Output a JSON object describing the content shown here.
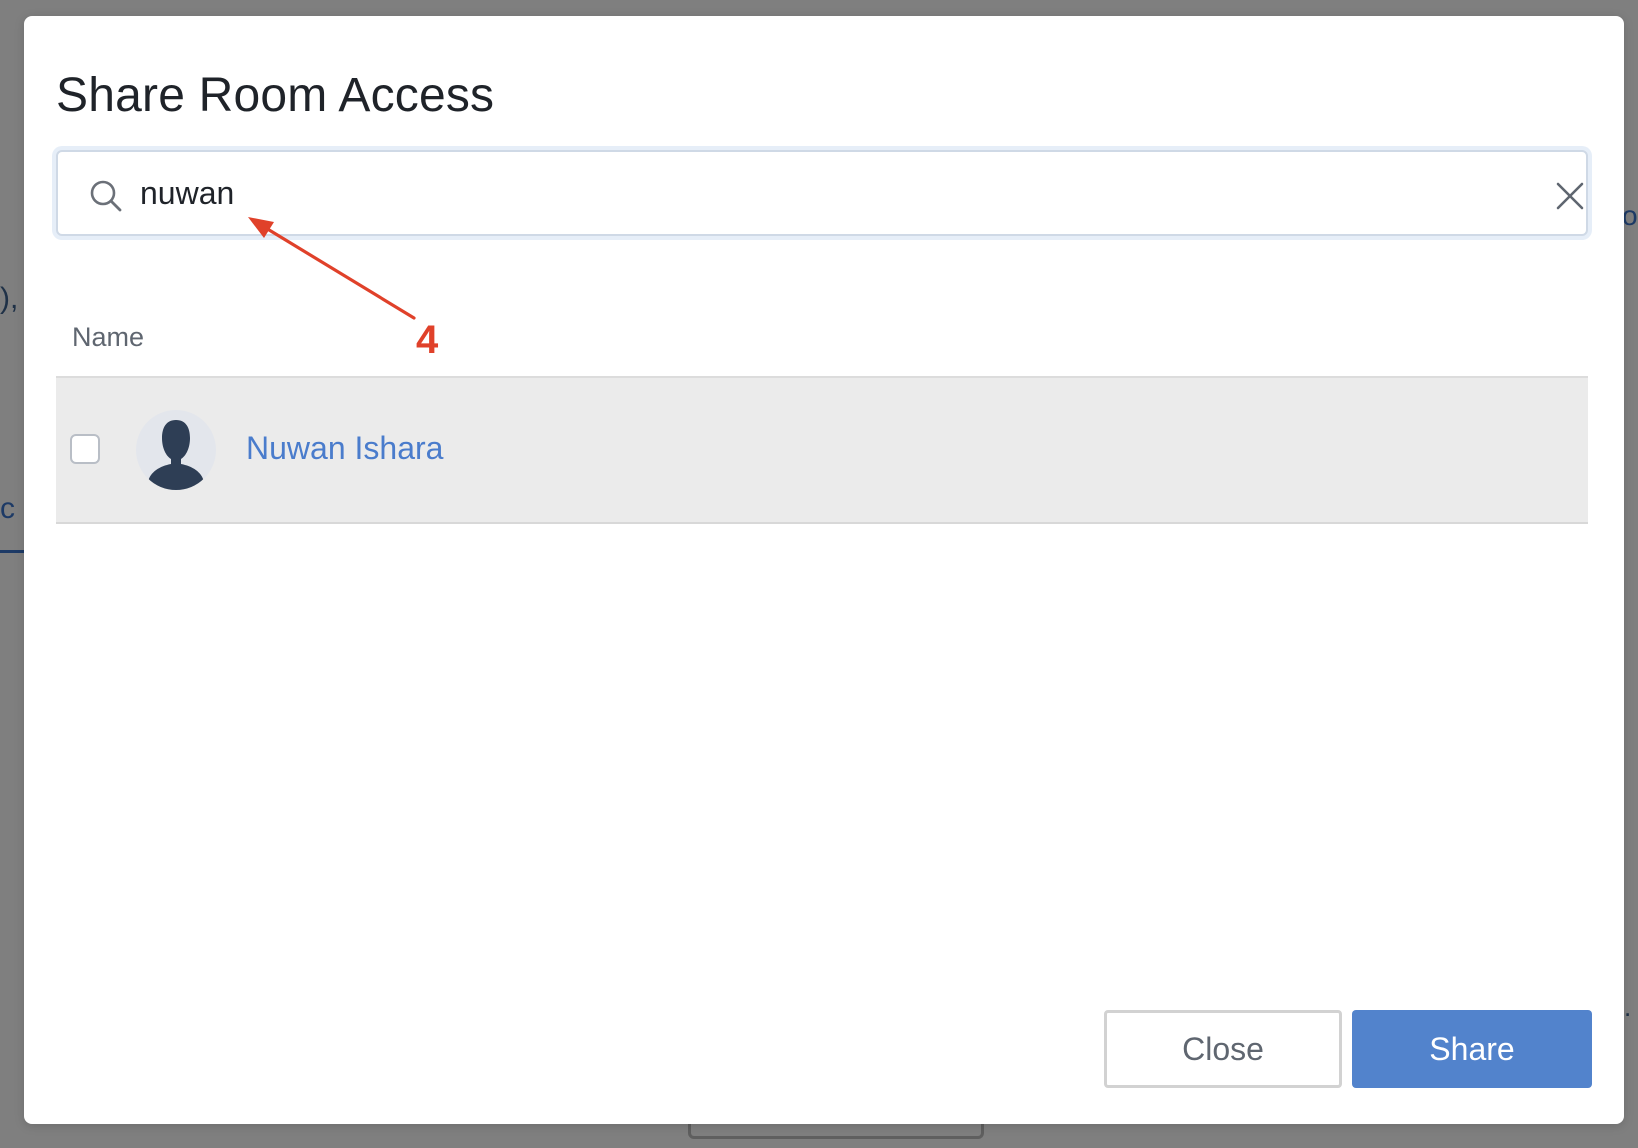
{
  "dialog": {
    "title": "Share Room Access"
  },
  "search": {
    "value": "nuwan",
    "icon": "search-icon",
    "clear_icon": "close-icon"
  },
  "annotation": {
    "label": "4",
    "color": "#e0412a"
  },
  "table": {
    "columns": [
      "Name"
    ],
    "rows": [
      {
        "name": "Nuwan Ishara",
        "checked": false,
        "avatar": "default-user-avatar"
      }
    ]
  },
  "footer": {
    "close_label": "Close",
    "share_label": "Share"
  },
  "colors": {
    "accent": "#5283cc",
    "link": "#4a7ccc",
    "overlay": "#7f7f7f",
    "row_highlight": "#ebebeb"
  },
  "background": {
    "left_fragment_1": "),",
    "left_fragment_2": "c",
    "right_fragment_1": "o",
    "right_fragment_2": "."
  }
}
